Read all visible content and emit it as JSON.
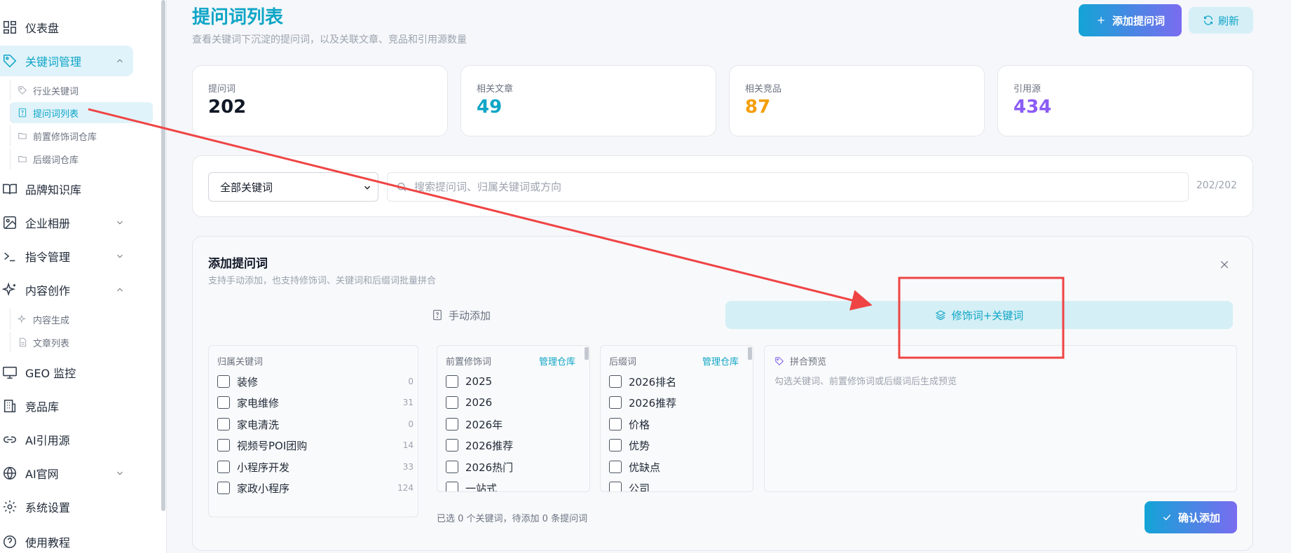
{
  "sidebar": {
    "items": [
      {
        "label": "仪表盘",
        "icon": "dashboard-icon"
      },
      {
        "label": "关键词管理",
        "icon": "tag-icon"
      },
      {
        "label": "品牌知识库",
        "icon": "book-icon"
      },
      {
        "label": "企业相册",
        "icon": "image-icon"
      },
      {
        "label": "指令管理",
        "icon": "terminal-icon"
      },
      {
        "label": "内容创作",
        "icon": "sparkle-icon"
      },
      {
        "label": "GEO 监控",
        "icon": "monitor-icon"
      },
      {
        "label": "竞品库",
        "icon": "building-icon"
      },
      {
        "label": "AI引用源",
        "icon": "link-icon"
      },
      {
        "label": "AI官网",
        "icon": "globe-icon"
      },
      {
        "label": "系统设置",
        "icon": "gear-icon"
      },
      {
        "label": "使用教程",
        "icon": "help-icon"
      }
    ],
    "keyword_sub": [
      {
        "label": "行业关键词",
        "icon": "tag-icon"
      },
      {
        "label": "提问词列表",
        "icon": "question-doc-icon"
      },
      {
        "label": "前置修饰词仓库",
        "icon": "folder-icon"
      },
      {
        "label": "后缀词仓库",
        "icon": "folder-icon"
      }
    ],
    "content_sub": [
      {
        "label": "内容生成",
        "icon": "sparkle-icon"
      },
      {
        "label": "文章列表",
        "icon": "document-icon"
      }
    ]
  },
  "header": {
    "title": "提问词列表",
    "subtitle": "查看关键词下沉淀的提问词，以及关联文章、竞品和引用源数量",
    "add_label": "添加提问词",
    "refresh_label": "刷新"
  },
  "stats": [
    {
      "label": "提问词",
      "value": "202",
      "color": "#111827"
    },
    {
      "label": "相关文章",
      "value": "49",
      "color": "#0ea5c6"
    },
    {
      "label": "相关竞品",
      "value": "87",
      "color": "#f59e0b"
    },
    {
      "label": "引用源",
      "value": "434",
      "color": "#8b5cf6"
    }
  ],
  "filter": {
    "select_value": "全部关键词",
    "search_placeholder": "搜索提问词、归属关键词或方向",
    "count": "202/202"
  },
  "panel": {
    "title": "添加提问词",
    "subtitle": "支持手动添加，也支持修饰词、关键词和后缀词批量拼合",
    "tab_manual": "手动添加",
    "tab_combo": "修饰词+关键词",
    "keywords": {
      "header": "归属关键词",
      "items": [
        {
          "label": "装修",
          "count": "0"
        },
        {
          "label": "家电维修",
          "count": "31"
        },
        {
          "label": "家电清洗",
          "count": "0"
        },
        {
          "label": "视频号POI团购",
          "count": "14"
        },
        {
          "label": "小程序开发",
          "count": "33"
        },
        {
          "label": "家政小程序",
          "count": "124"
        }
      ]
    },
    "prefix": {
      "header": "前置修饰词",
      "manage": "管理仓库",
      "items": [
        "2025",
        "2026",
        "2026年",
        "2026推荐",
        "2026热门",
        "一站式"
      ]
    },
    "suffix": {
      "header": "后缀词",
      "manage": "管理仓库",
      "items": [
        "2026排名",
        "2026推荐",
        "价格",
        "优势",
        "优缺点",
        "公司"
      ]
    },
    "preview": {
      "header": "拼合预览",
      "hint": "勾选关键词、前置修饰词或后缀词后生成预览"
    },
    "status": "已选 0 个关键词，待添加 0 条提问词",
    "confirm_label": "确认添加"
  },
  "colors": {
    "accent": "#0ea5c6",
    "annotation": "#ef4444"
  }
}
